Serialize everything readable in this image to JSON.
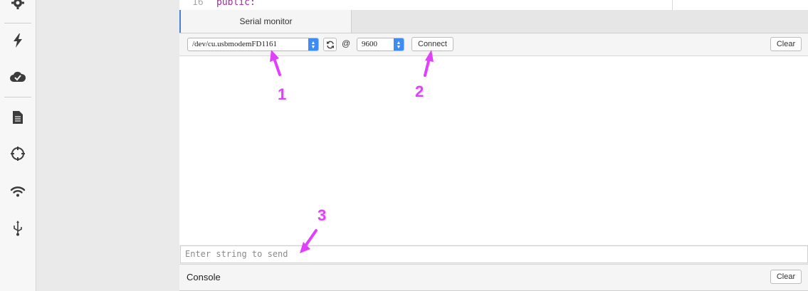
{
  "sidebar": {
    "icons": [
      "gear-icon",
      "bolt-icon",
      "cloud-check-icon",
      "file-icon",
      "crosshair-icon",
      "wifi-icon",
      "usb-icon"
    ]
  },
  "editor": {
    "line_number": "16",
    "code_text": "public:"
  },
  "panel": {
    "tab_label": "Serial monitor",
    "accent_color": "#4a7fd6"
  },
  "toolbar": {
    "port_value": "/dev/cu.usbmodemFD1161",
    "refresh_icon": "refresh-icon",
    "at_symbol": "@",
    "baud_value": "9600",
    "connect_label": "Connect",
    "clear_label": "Clear"
  },
  "send": {
    "placeholder": "Enter string to send"
  },
  "console": {
    "label": "Console",
    "clear_label": "Clear"
  },
  "annotations": {
    "color": "#e040fb",
    "markers": [
      "1",
      "2",
      "3"
    ]
  }
}
